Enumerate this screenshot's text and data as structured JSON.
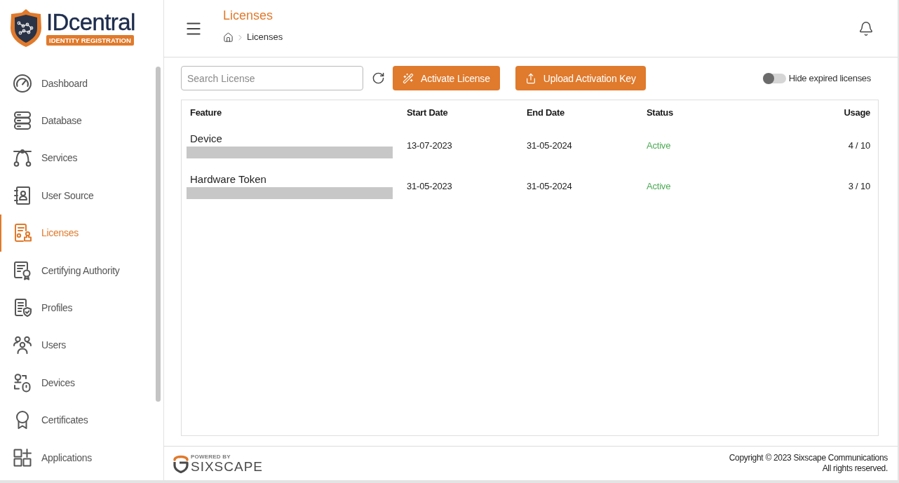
{
  "sidebar": {
    "logo": {
      "name": "IDcentral",
      "tagline": "IDENTITY REGISTRATION"
    },
    "items": [
      {
        "label": "Dashboard",
        "selected": false
      },
      {
        "label": "Database",
        "selected": false
      },
      {
        "label": "Services",
        "selected": false
      },
      {
        "label": "User Source",
        "selected": false
      },
      {
        "label": "Licenses",
        "selected": true
      },
      {
        "label": "Certifying Authority",
        "selected": false
      },
      {
        "label": "Profiles",
        "selected": false
      },
      {
        "label": "Users",
        "selected": false
      },
      {
        "label": "Devices",
        "selected": false
      },
      {
        "label": "Certificates",
        "selected": false
      },
      {
        "label": "Applications",
        "selected": false
      }
    ]
  },
  "header": {
    "title": "Licenses",
    "breadcrumb": [
      "Licenses"
    ]
  },
  "toolbar": {
    "search": {
      "placeholder": "Search License"
    },
    "buttons": [
      {
        "label": "Activate License"
      },
      {
        "label": "Upload Activation Key"
      }
    ],
    "toggle": {
      "label": "Hide expired licenses",
      "on": false
    }
  },
  "table": {
    "columns": [
      "Feature",
      "Start Date",
      "End Date",
      "Status",
      "Usage"
    ],
    "rows": [
      {
        "feature": "Device",
        "redacted": true,
        "start_date": "13-07-2023",
        "end_date": "31-05-2024",
        "status": {
          "label": "Active",
          "kind": "active"
        },
        "usage": "4 / 10"
      },
      {
        "feature": "Hardware Token",
        "redacted": true,
        "start_date": "31-05-2023",
        "end_date": "31-05-2024",
        "status": {
          "label": "Active",
          "kind": "active"
        },
        "usage": "3 / 10"
      }
    ]
  },
  "footer": {
    "logo": {
      "tagline": "POWERED BY",
      "name": "SIXSCAPE"
    },
    "copyright": [
      "Copyright © 2023 Sixscape Communications",
      "All rights reserved."
    ]
  }
}
